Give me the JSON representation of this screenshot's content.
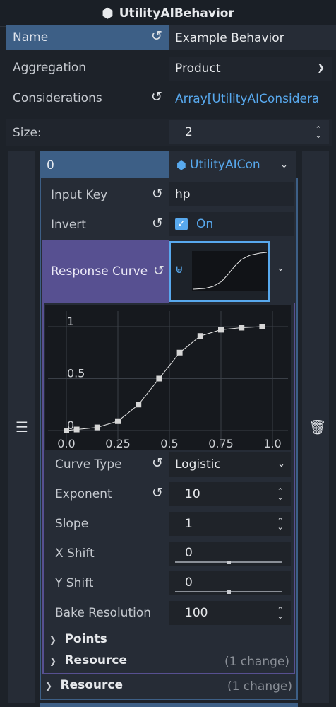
{
  "header": {
    "title": "UtilityAIBehavior",
    "icon": "cube-icon"
  },
  "props": {
    "name_label": "Name",
    "name_value": "Example Behavior",
    "aggregation_label": "Aggregation",
    "aggregation_value": "Product",
    "considerations_label": "Considerations",
    "considerations_value": "Array[UtilityAIConsidera",
    "size_label": "Size:",
    "size_value": "2"
  },
  "element": {
    "index": "0",
    "resource_type": "UtilityAICon",
    "input_key_label": "Input Key",
    "input_key_value": "hp",
    "invert_label": "Invert",
    "invert_value": "On",
    "response_curve_label": "Response Curve",
    "curve_type_label": "Curve Type",
    "curve_type_value": "Logistic",
    "exponent_label": "Exponent",
    "exponent_value": "10",
    "slope_label": "Slope",
    "slope_value": "1",
    "x_shift_label": "X Shift",
    "x_shift_value": "0",
    "y_shift_label": "Y Shift",
    "y_shift_value": "0",
    "bake_label": "Bake Resolution",
    "bake_value": "100",
    "points_label": "Points",
    "resource_label": "Resource",
    "resource_change": "(1 change)"
  },
  "outer_resource": {
    "label": "Resource",
    "change": "(1 change)"
  },
  "colors": {
    "accent": "#58a9ee",
    "selected_row": "#3d5f86",
    "curve_section": "#575091",
    "panel": "#262c36"
  },
  "chart_data": {
    "type": "line",
    "x": [
      0.0,
      0.05,
      0.15,
      0.25,
      0.35,
      0.45,
      0.55,
      0.65,
      0.75,
      0.85,
      0.95
    ],
    "values": [
      0.0,
      0.01,
      0.03,
      0.09,
      0.25,
      0.5,
      0.75,
      0.91,
      0.97,
      0.99,
      1.0
    ],
    "x_ticks": [
      "0.0",
      "0.25",
      "0.5",
      "0.75",
      "1.0"
    ],
    "y_ticks": [
      "0",
      "0.5",
      "1"
    ],
    "xlim": [
      0,
      1
    ],
    "ylim": [
      0,
      1
    ]
  }
}
